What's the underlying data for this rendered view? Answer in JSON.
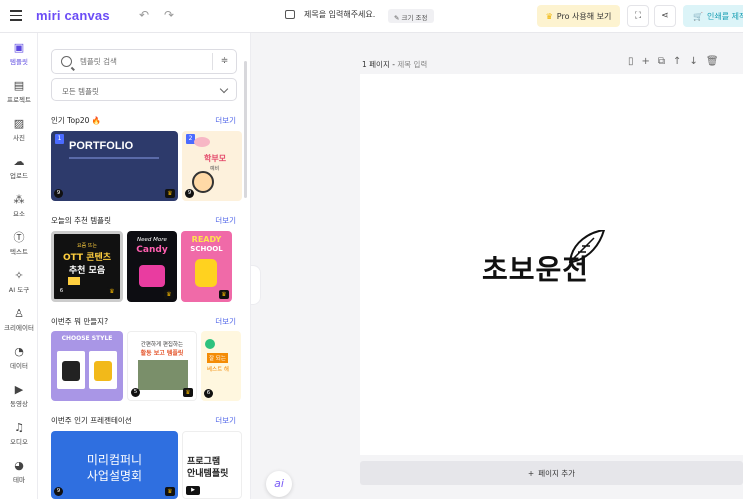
{
  "topbar": {
    "logo": "miri canvas",
    "undo_icon": "undo-icon",
    "redo_icon": "redo-icon",
    "doc_title": "제목을 입력해주세요.",
    "resize_label": "크기 조정",
    "pro_label": "Pro 사용해 보기",
    "print_label": "인쇄를 제작"
  },
  "leftnav": {
    "items": [
      {
        "label": "템플릿",
        "icon": "template-icon"
      },
      {
        "label": "프로젝트",
        "icon": "project-icon"
      },
      {
        "label": "사진",
        "icon": "photo-icon"
      },
      {
        "label": "업로드",
        "icon": "upload-icon"
      },
      {
        "label": "요소",
        "icon": "elements-icon"
      },
      {
        "label": "텍스트",
        "icon": "text-icon"
      },
      {
        "label": "AI 도구",
        "icon": "ai-tools-icon"
      },
      {
        "label": "크리에이터",
        "icon": "creator-icon"
      },
      {
        "label": "데이터",
        "icon": "data-icon"
      },
      {
        "label": "동영상",
        "icon": "video-icon"
      },
      {
        "label": "오디오",
        "icon": "audio-icon"
      },
      {
        "label": "테마",
        "icon": "theme-icon"
      }
    ]
  },
  "panel": {
    "search_placeholder": "템플릿 검색",
    "select_value": "모든 템플릿",
    "more_label": "더보기",
    "sections": [
      {
        "title": "인기 Top20 🔥"
      },
      {
        "title": "오늘의 추천 템플릿"
      },
      {
        "title": "이번주 뭐 만들지?"
      },
      {
        "title": "이번주 인기 프레젠테이션"
      }
    ],
    "thumbs": {
      "portfolio_title": "PORTFOLIO",
      "portfolio_sub": "PORTFOLIO",
      "t2_text": "학부모 ",
      "t2_sub": "예비 ",
      "ott_small": "요즘 뜨는",
      "ott_title": "OTT 콘텐츠",
      "ott_sub": "추천 모음",
      "candy_small": "Need More",
      "candy_title": "Candy",
      "ready_title": "READY",
      "ready_sub": "SCHOOL",
      "choose": "CHOOSE STYLE",
      "edit_small": "간편하게 편집하는",
      "edit_title": "활동 보고 템플릿",
      "pres_title1": "미리컴퍼니",
      "pres_title2": "사업설명회",
      "prog1": "프로그램",
      "prog2": "안내템플릿",
      "t3a": "잘 되는",
      "t3b": "베스트 해"
    },
    "num1": "1",
    "num2": "2",
    "badge9": "9",
    "badge6": "6",
    "badge5": "5"
  },
  "editor": {
    "page_label": "1 페이지",
    "page_title_placeholder": "제목 입력",
    "add_page": "페이지 추가",
    "artwork_text": "초보운전",
    "ai_label": "ai"
  }
}
